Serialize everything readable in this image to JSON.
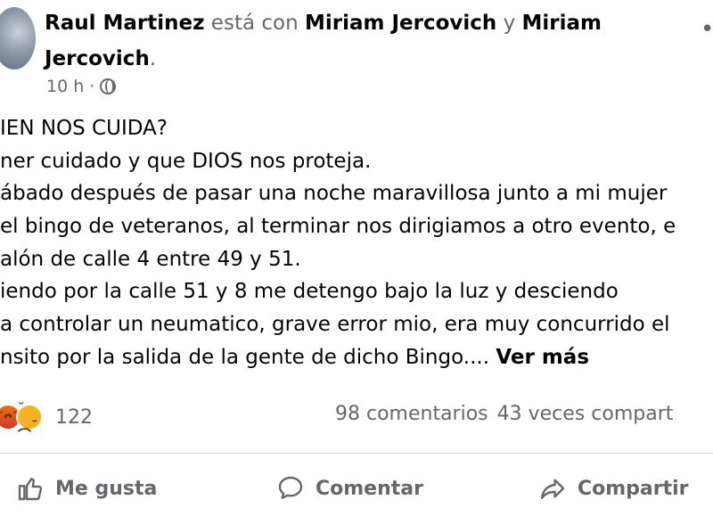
{
  "post": {
    "author": "Raul Martinez",
    "connector": " está con ",
    "tagged1": "Miriam Jercovich",
    "connector2": " y ",
    "tagged2": "Miriam Jercovich",
    "period": ".",
    "time": "10 h",
    "separator": "·",
    "lines": [
      "IEN NOS CUIDA?",
      "ner cuidado y que DIOS nos proteja.",
      "ábado después de pasar una noche maravillosa junto a mi mujer",
      "el bingo de veteranos, al terminar nos dirigiamos a otro evento, e",
      "alón de calle 4 entre 49 y 51.",
      "iendo por la calle 51 y 8 me detengo bajo la luz y desciendo",
      "a controlar un neumatico, grave error mio, era muy concurrido el",
      "nsito por la salida de la gente de dicho Bingo...."
    ],
    "see_more": "Ver más"
  },
  "reactions": {
    "count": "122",
    "comments": "98 comentarios",
    "shares": "43 veces compart"
  },
  "actions": {
    "like": "Me gusta",
    "comment": "Comentar",
    "share": "Compartir"
  },
  "icons": {
    "privacy": "globe-icon",
    "more": "more-options-icon",
    "like": "thumbs-up-icon",
    "comment": "comment-bubble-icon",
    "share": "share-arrow-icon"
  },
  "colors": {
    "text": "#050505",
    "secondary": "#65676b",
    "divider": "#ced0d4",
    "angry": "#e9710f",
    "sad": "#f7b125"
  }
}
